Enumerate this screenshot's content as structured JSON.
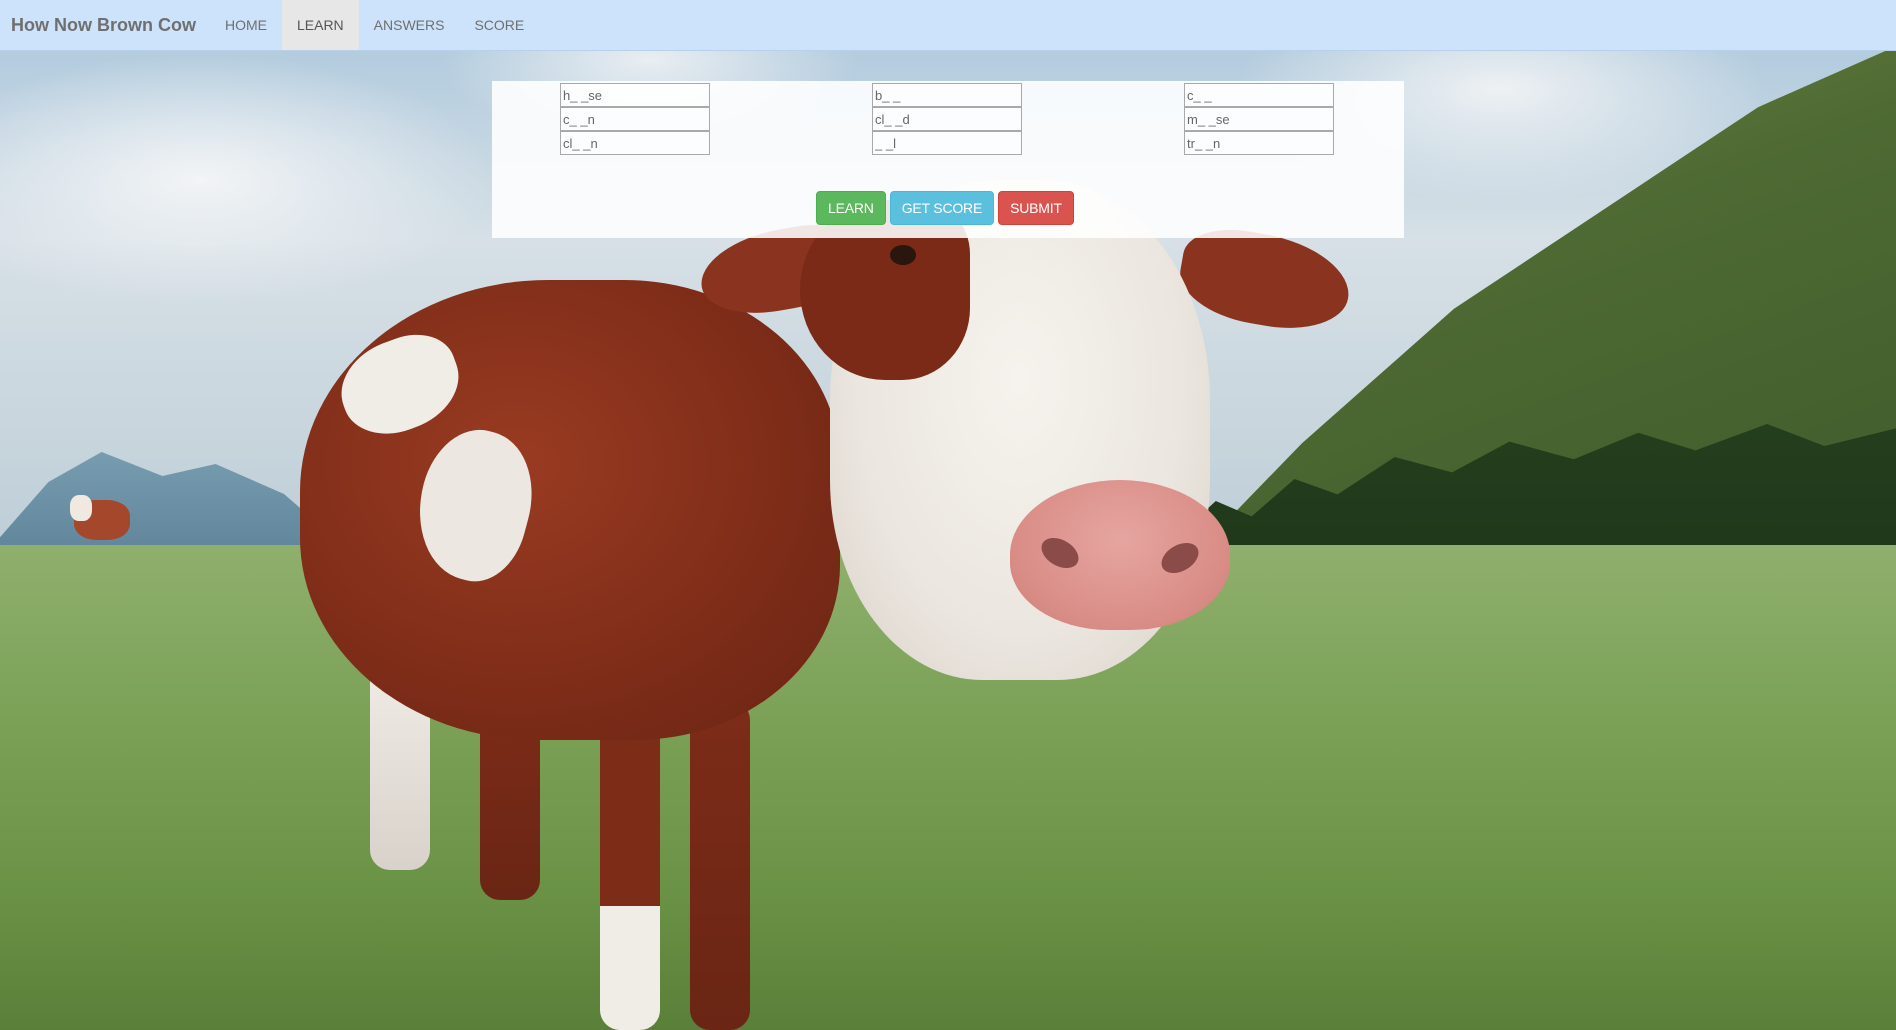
{
  "navbar": {
    "brand": "How Now Brown Cow",
    "items": [
      {
        "label": "HOME",
        "active": false
      },
      {
        "label": "LEARN",
        "active": true
      },
      {
        "label": "ANSWERS",
        "active": false
      },
      {
        "label": "SCORE",
        "active": false
      }
    ]
  },
  "quiz": {
    "columns": [
      [
        "h_ _se",
        "c_ _n",
        "cl_ _n"
      ],
      [
        "b_ _",
        "cl_ _d",
        "_ _l"
      ],
      [
        "c_ _",
        "m_ _se",
        "tr_ _n"
      ]
    ]
  },
  "buttons": {
    "learn": "LEARN",
    "get_score": "GET SCORE",
    "submit": "SUBMIT"
  },
  "colors": {
    "navbar_bg": "#cde3fb",
    "learn_button": "#5cb85c",
    "get_score_button": "#5bc0de",
    "submit_button": "#d9534f"
  }
}
